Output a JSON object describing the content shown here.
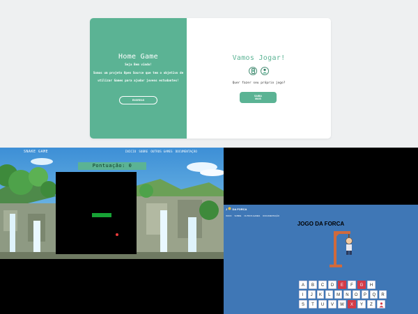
{
  "home": {
    "title": "Home Game",
    "welcome": "Seja Bem vindo!",
    "description": "Somos um projeto Open Source que tem o objetivo de utilizar Games para ajudar jovens estudantes!",
    "button_label": "ENGREAS",
    "right_title": "Vamos Jogar!",
    "question": "Quer fazer seu próprio jogo?",
    "more_button_line1": "SAIBA",
    "more_button_line2": "MAIS",
    "icons": [
      "phone-icon",
      "person-icon"
    ],
    "colors": {
      "accent": "#5bb394",
      "background": "#eef0f1"
    }
  },
  "snake": {
    "brand": "SNAKE GAME",
    "nav": [
      "INICIO",
      "SOBRE",
      "OUTROS GAMES",
      "DOCUMENTAÇÃO"
    ],
    "score_label": "Pontuação:",
    "score_value": "0"
  },
  "hangman": {
    "logo_prefix": "J",
    "logo_text": "DA FORCA",
    "nav": [
      "INICIO",
      "SOBRE",
      "OUTROS GAMES",
      "DOCUMENTAÇÃO"
    ],
    "title": "JOGO DA FORCA",
    "keyboard_rows": [
      [
        "A",
        "B",
        "C",
        "D",
        "E",
        "F",
        "G",
        "H"
      ],
      [
        "I",
        "J",
        "K",
        "L",
        "M",
        "N",
        "O",
        "P",
        "Q",
        "R"
      ],
      [
        "S",
        "T",
        "U",
        "V",
        "W",
        "X",
        "Y",
        "Z"
      ]
    ],
    "used_letters": [
      "E",
      "G",
      "X"
    ],
    "colors": {
      "page": "#3f77b6",
      "used_key": "#d33b48"
    }
  }
}
